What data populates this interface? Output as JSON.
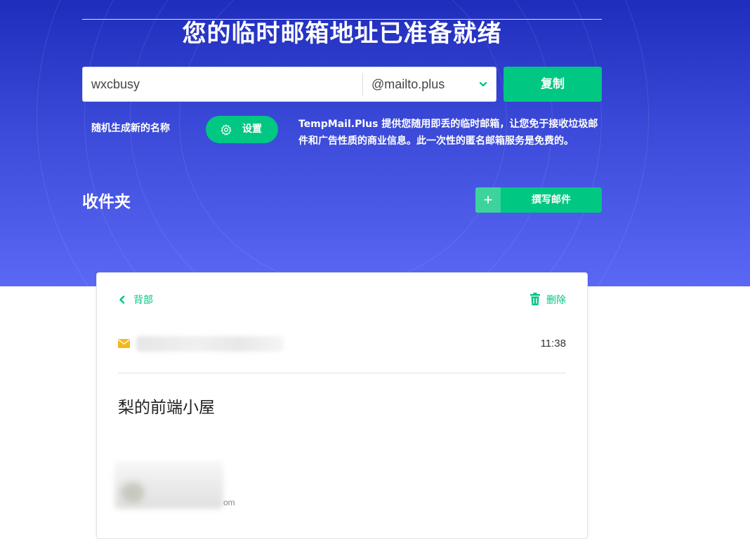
{
  "hero": {
    "title": "您的临时邮箱地址已准备就绪",
    "address_name": "wxcbusy",
    "address_domain": "@mailto.plus",
    "copy_label": "复制",
    "random_label": "随机生成新的名称",
    "settings_label": "设置",
    "description": "TempMail.Plus 提供您随用即丢的临时邮箱，让您免于接收垃圾邮件和广告性质的商业信息。此一次性的匿名邮箱服务是免费的。"
  },
  "inbox": {
    "title": "收件夹",
    "compose_label": "撰写邮件"
  },
  "message": {
    "back_label": "背部",
    "delete_label": "删除",
    "sender": "",
    "time": "11:38",
    "subject": "梨的前端小屋",
    "body_tail": "om"
  },
  "colors": {
    "accent": "#00c781",
    "hero_top": "#1f2dbd",
    "hero_bottom": "#5a68f5"
  }
}
